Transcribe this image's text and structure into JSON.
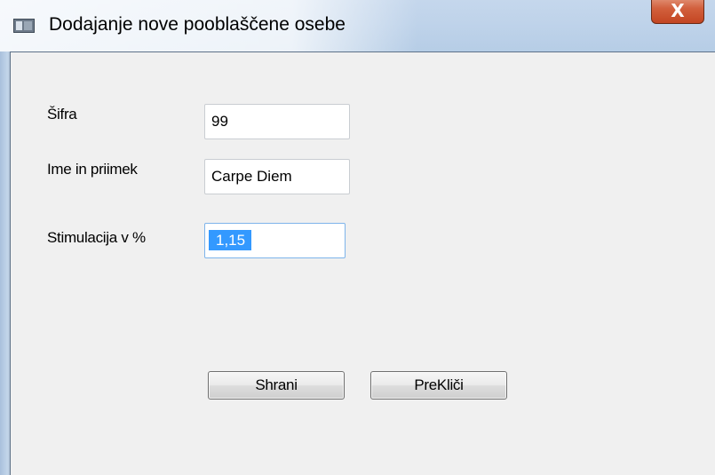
{
  "window": {
    "title": "Dodajanje nove pooblaščene osebe",
    "close_glyph": "X"
  },
  "form": {
    "sifra": {
      "label": "Šifra",
      "value": "99"
    },
    "ime_priimek": {
      "label": "Ime  in priimek",
      "value": "Carpe Diem"
    },
    "stimulacija": {
      "label": "Stimulacija v %",
      "value": "1,15",
      "selected": true
    }
  },
  "buttons": {
    "save_label": "Shrani",
    "cancel_label": "PreKliči"
  },
  "colors": {
    "selection": "#3399ff",
    "focus_border": "#7eb4ea",
    "close_button": "#d2603d",
    "titlebar": "#bfd3ea"
  },
  "icons": {
    "app": "window-app-icon",
    "close": "close-icon"
  }
}
